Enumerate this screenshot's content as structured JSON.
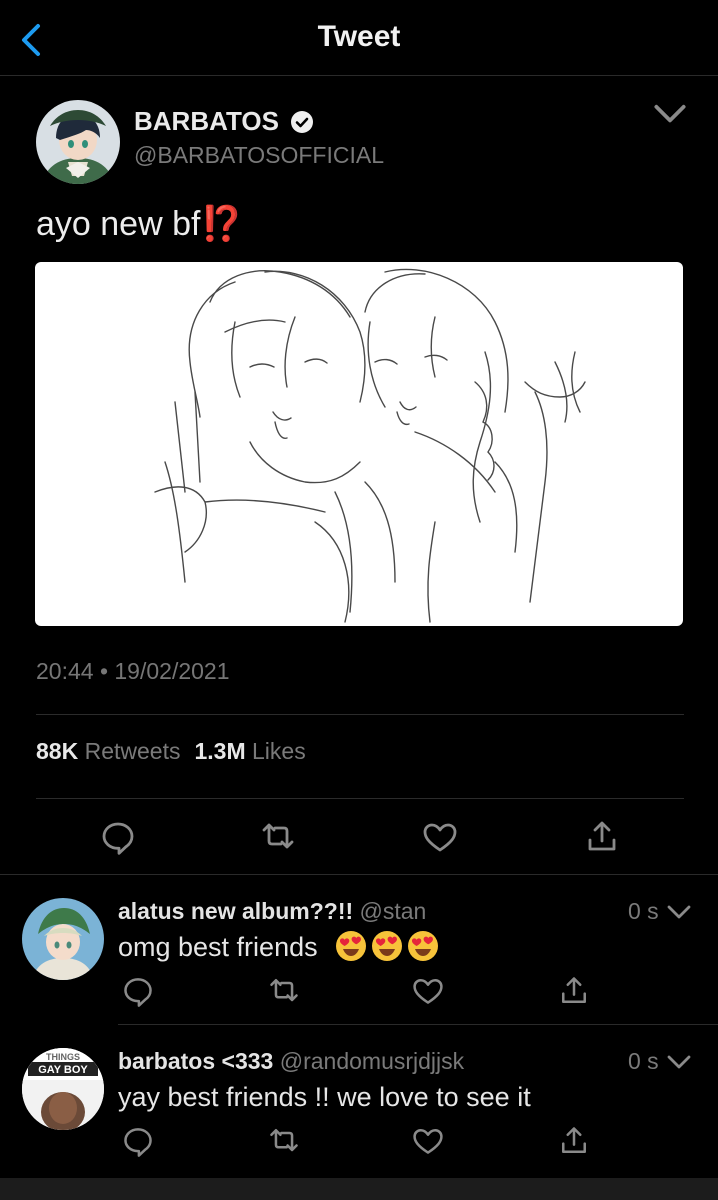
{
  "header": {
    "title": "Tweet"
  },
  "tweet": {
    "author_name": "BARBATOS",
    "author_handle": "@BARBATOSOFFICIAL",
    "text": "ayo new bf",
    "emoji": "⁉️",
    "timestamp": "20:44 • 19/02/2021",
    "stats": [
      {
        "num": "88K",
        "label": "Retweets"
      },
      {
        "num": "1.3M",
        "label": "Likes"
      }
    ]
  },
  "replies": [
    {
      "name": "alatus new album??!!",
      "handle": "@stan",
      "time": "0 s",
      "text": "omg best friends"
    },
    {
      "name": "barbatos <333",
      "handle": "@randomusrjdjjsk",
      "time": "0 s",
      "text": "yay best friends !! we love to see it",
      "avatar_text": "GAY BOY",
      "avatar_text_top": "THINGS"
    }
  ],
  "icons": [
    "back-chevron-icon",
    "verified-badge-icon",
    "chevron-down-icon",
    "reply-icon",
    "retweet-icon",
    "like-icon",
    "share-icon",
    "heart-eyes-emoji"
  ],
  "colors": {
    "accent": "#1d9bf0",
    "background": "#000000",
    "secondary_text": "#7a7a7a"
  }
}
